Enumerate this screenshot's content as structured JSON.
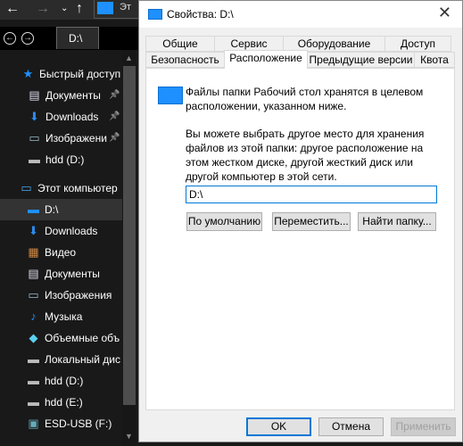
{
  "explorer": {
    "address_partial": "Эт",
    "tab_label": "D:\\",
    "quick_access": [
      {
        "label": "Быстрый доступ",
        "icon": "star-icon",
        "pinned": false
      },
      {
        "label": "Документы",
        "icon": "document-icon",
        "pinned": true
      },
      {
        "label": "Downloads",
        "icon": "download-icon",
        "pinned": true
      },
      {
        "label": "Изображени",
        "icon": "image-icon",
        "pinned": true
      },
      {
        "label": "hdd (D:)",
        "icon": "drive-icon",
        "pinned": false
      }
    ],
    "this_pc": [
      {
        "label": "Этот компьютер",
        "icon": "computer-icon"
      },
      {
        "label": "D:\\",
        "icon": "desktop-icon",
        "selected": true
      },
      {
        "label": "Downloads",
        "icon": "download-icon"
      },
      {
        "label": "Видео",
        "icon": "video-icon"
      },
      {
        "label": "Документы",
        "icon": "document-icon"
      },
      {
        "label": "Изображения",
        "icon": "image-icon"
      },
      {
        "label": "Музыка",
        "icon": "music-icon"
      },
      {
        "label": "Объемные объ",
        "icon": "3d-objects-icon"
      },
      {
        "label": "Локальный дис",
        "icon": "local-disk-icon"
      },
      {
        "label": "hdd (D:)",
        "icon": "drive-icon"
      },
      {
        "label": "hdd (E:)",
        "icon": "drive-icon"
      },
      {
        "label": "ESD-USB (F:)",
        "icon": "usb-drive-icon"
      }
    ]
  },
  "dialog": {
    "title": "Свойства: D:\\",
    "tabs_row1": [
      "Общие",
      "Сервис",
      "Оборудование",
      "Доступ"
    ],
    "tabs_row2": [
      "Безопасность",
      "Расположение",
      "Предыдущие версии",
      "Квота"
    ],
    "active_tab": "Расположение",
    "info_text": "Файлы папки Рабочий стол хранятся в целевом расположении, указанном ниже.",
    "desc_text": "Вы можете выбрать другое место для хранения файлов из этой папки: другое расположение на этом жестком диске, другой жесткий диск или другой компьютер в этой сети.",
    "path_value": "D:\\",
    "btn_default": "По умолчанию",
    "btn_move": "Переместить...",
    "btn_find": "Найти папку...",
    "ok": "OK",
    "cancel": "Отмена",
    "apply": "Применить"
  }
}
